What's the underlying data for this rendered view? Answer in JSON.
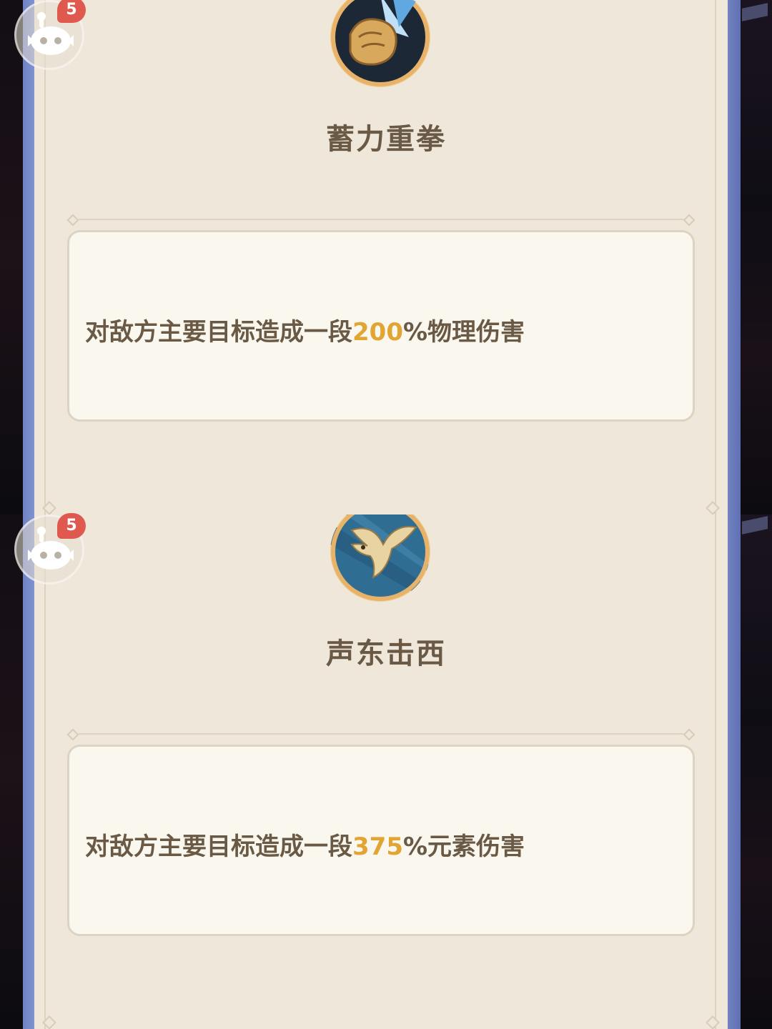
{
  "notifications": {
    "badge_count": "5"
  },
  "skills": [
    {
      "name": "蓄力重拳",
      "icon": "fist-strike-icon",
      "description_prefix": "对敌方主要目标造成一段",
      "description_value": "200",
      "description_suffix": "%物理伤害"
    },
    {
      "name": "声东击西",
      "icon": "eagle-icon",
      "description_prefix": "对敌方主要目标造成一段",
      "description_value": "375",
      "description_suffix": "%元素伤害"
    }
  ],
  "colors": {
    "frame_blue": "#7d90cc",
    "panel_bg": "#efe8da",
    "text_brown": "#6a5a45",
    "highlight_gold": "#e2a433",
    "badge_red": "#e0594e"
  }
}
